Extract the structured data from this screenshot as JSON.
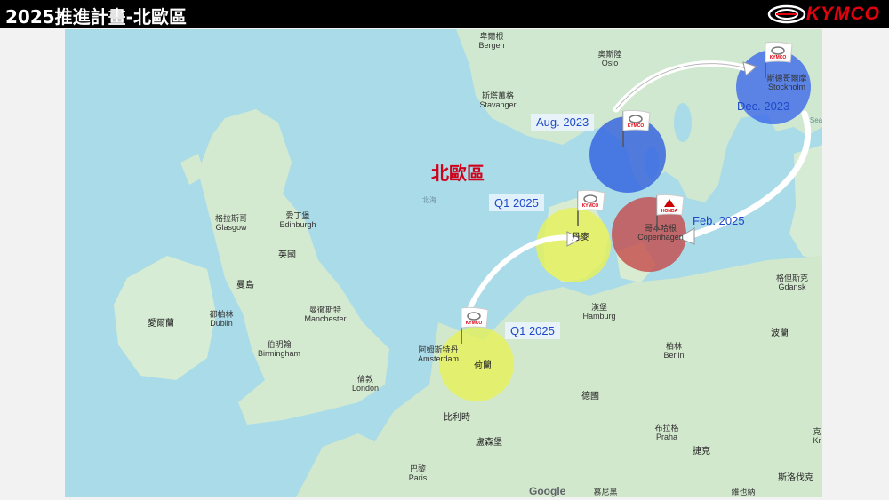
{
  "slide": {
    "title": "2025推進計畫-北歐區"
  },
  "brand": {
    "name": "KYMCO",
    "color": "#e3000f"
  },
  "region_title": "北歐區",
  "callouts": {
    "aug": "Aug. 2023",
    "dec": "Dec. 2023",
    "q1_dk": "Q1 2025",
    "feb": "Feb. 2025",
    "q1_nl": "Q1 2025"
  },
  "flags": {
    "kymco": "KYMCO",
    "honda": "HONDA"
  },
  "map_labels": {
    "bergen": "卑爾根\nBergen",
    "oslo": "奧斯陸\nOslo",
    "stavanger": "斯塔萬格\nStavanger",
    "stockholm": "斯德哥爾摩\nStockholm",
    "north_sea": "北海",
    "glasgow": "格拉斯哥\nGlasgow",
    "edinburgh": "愛丁堡\nEdinburgh",
    "uk": "英國",
    "isle_of_man": "曼島",
    "ireland": "愛爾蘭",
    "dublin": "都柏林\nDublin",
    "manchester": "曼徹斯特\nManchester",
    "birmingham": "伯明翰\nBirmingham",
    "london": "倫敦\nLondon",
    "denmark": "丹麥",
    "copenhagen": "哥本哈根\nCopenhagen",
    "hamburg": "漢堡\nHamburg",
    "amsterdam": "阿姆斯特丹\nAmsterdam",
    "netherlands": "荷蘭",
    "berlin": "柏林\nBerlin",
    "gdansk": "格但斯克\nGdansk",
    "poland": "波蘭",
    "germany": "德國",
    "belgium": "比利時",
    "luxembourg": "盧森堡",
    "prague": "布拉格\nPraha",
    "czech": "捷克",
    "paris": "巴黎\nParis",
    "munich": "慕尼黑",
    "vienna": "維也納",
    "slovakia": "斯洛伐克",
    "sea": "Sea",
    "kr": "克\nKr"
  },
  "google": "Google",
  "colors": {
    "water": "#a9dbe8",
    "land": "#cfe8cf",
    "circle_blue": "#2f5fe0",
    "circle_red": "#c44a4a",
    "circle_yellow": "#e6f05a",
    "callout_text": "#1f49c8",
    "region_title": "#d0021b"
  }
}
